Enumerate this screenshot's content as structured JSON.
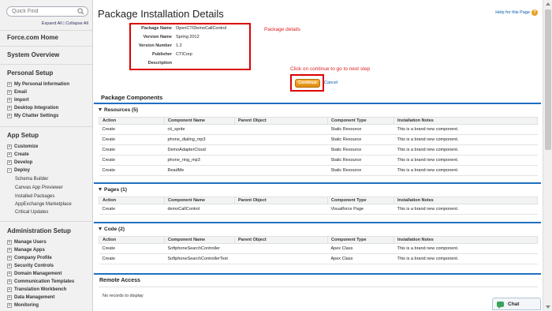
{
  "sidebar": {
    "quick_find_placeholder": "Quick Find",
    "expand_all": "Expand All",
    "separator": "|",
    "collapse_all": "Collapse All",
    "home": "Force.com Home",
    "system_overview": "System Overview",
    "personal_setup": {
      "title": "Personal Setup",
      "items": [
        "My Personal Information",
        "Email",
        "Import",
        "Desktop Integration",
        "My Chatter Settings"
      ]
    },
    "app_setup": {
      "title": "App Setup",
      "items": [
        "Customize",
        "Create",
        "Develop",
        "Deploy"
      ],
      "subitems": [
        "Schema Builder",
        "Canvas App Previewer",
        "Installed Packages",
        "AppExchange Marketplace",
        "Critical Updates"
      ]
    },
    "admin_setup": {
      "title": "Administration Setup",
      "items": [
        "Manage Users",
        "Manage Apps",
        "Company Profile",
        "Security Controls",
        "Domain Management",
        "Communication Templates",
        "Translation Workbench",
        "Data Management",
        "Monitoring"
      ]
    }
  },
  "main": {
    "title": "Package Installation Details",
    "help_link": "Help for this Page",
    "help_icon_glyph": "?",
    "details": [
      {
        "label": "Package Name",
        "value": "OpenCTIDemoCallControl"
      },
      {
        "label": "Version Name",
        "value": "Spring 2012"
      },
      {
        "label": "Version Number",
        "value": "1.2"
      },
      {
        "label": "Publisher",
        "value": "CTICorp"
      },
      {
        "label": "Description",
        "value": ""
      }
    ],
    "annotation_details": "Package details",
    "annotation_continue": "Click on continue to go to next step",
    "continue_button": "Continue",
    "cancel_link": "Cancel",
    "package_components_title": "Package Components",
    "columns": [
      "Action",
      "Component Name",
      "Parent Object",
      "Component Type",
      "Installation Notes"
    ],
    "sections": [
      {
        "title": "Resources (5)",
        "rows": [
          [
            "Create",
            "cti_sprite",
            "",
            "Static Resource",
            "This is a brand new component."
          ],
          [
            "Create",
            "phone_dialing_mp3",
            "",
            "Static Resource",
            "This is a brand new component."
          ],
          [
            "Create",
            "DemoAdapterCloud",
            "",
            "Static Resource",
            "This is a brand new component."
          ],
          [
            "Create",
            "phone_ring_mp3",
            "",
            "Static Resource",
            "This is a brand new component."
          ],
          [
            "Create",
            "ReadMe",
            "",
            "Static Resource",
            "This is a brand new component."
          ]
        ]
      },
      {
        "title": "Pages (1)",
        "rows": [
          [
            "Create",
            "demoCallControl",
            "",
            "Visualforce Page",
            "This is a brand new component."
          ]
        ]
      },
      {
        "title": "Code (2)",
        "rows": [
          [
            "Create",
            "SoftphoneSearchController",
            "",
            "Apex Class",
            "This is a brand new component."
          ],
          [
            "Create",
            "SoftphoneSearchControllerTest",
            "",
            "Apex Class",
            "This is a brand new component."
          ]
        ]
      }
    ],
    "remote_access_title": "Remote Access",
    "remote_access_empty": "No records to display"
  },
  "chat": {
    "label": "Chat"
  },
  "colors": {
    "accent": "#1f6fc1",
    "annotation": "#dd0000",
    "button": "#e08a10",
    "link": "#015ba7"
  }
}
